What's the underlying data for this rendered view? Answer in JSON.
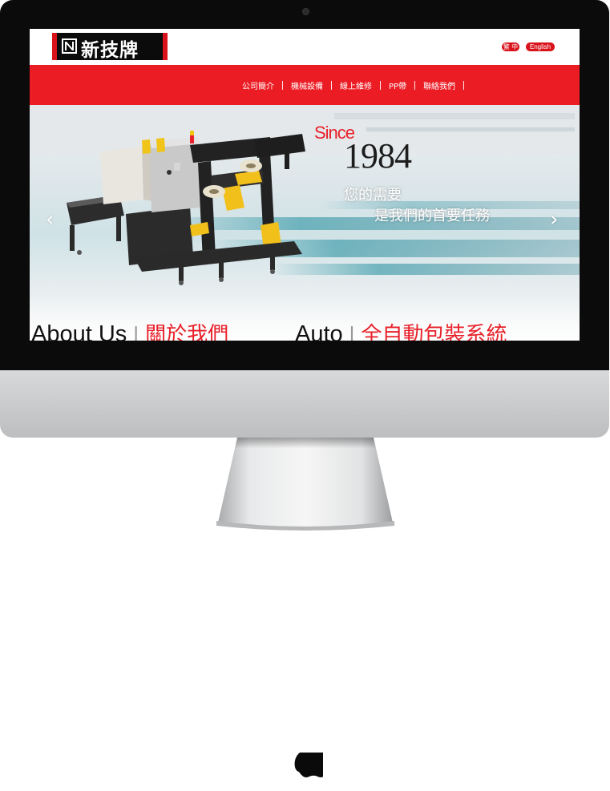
{
  "header": {
    "logo_text": "新技牌",
    "lang_zh": "繁 中",
    "lang_en": "English"
  },
  "nav": {
    "items": [
      "公司簡介",
      "機械設備",
      "線上維修",
      "PP帶",
      "聯絡我們"
    ]
  },
  "hero": {
    "since": "Since",
    "year": "1984",
    "slogan_line1": "您的需要",
    "slogan_line2": "是我們的首要任務",
    "prev_arrow": "‹",
    "next_arrow": "›"
  },
  "sections": {
    "about_en": "About Us",
    "about_zh": "關於我們",
    "auto_en": "Auto",
    "auto_zh": "全自動包裝系統",
    "separator": "|"
  },
  "colors": {
    "brand_red": "#ec1c24",
    "logo_black": "#0b0b0b"
  }
}
